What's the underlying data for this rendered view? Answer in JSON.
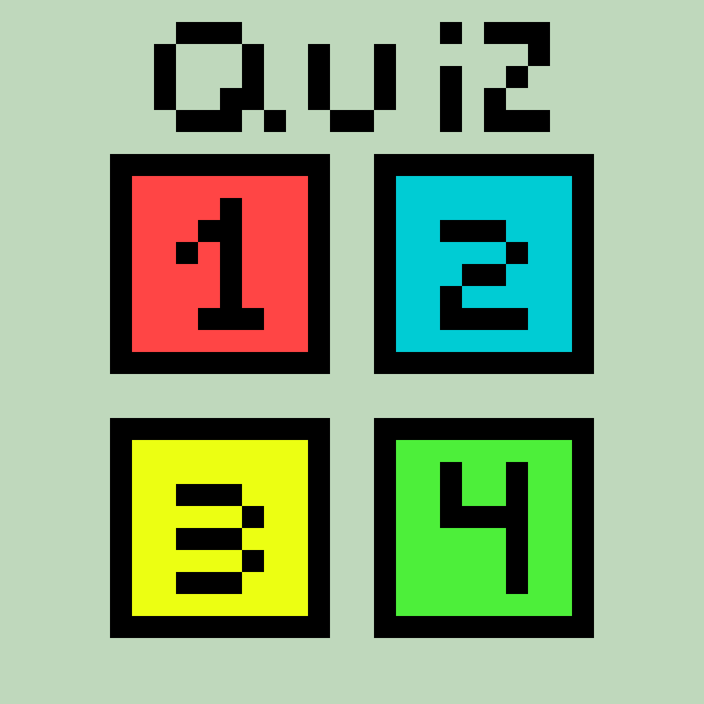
{
  "title": "Quiz",
  "background_color": "#BFD8BC",
  "border_color": "#000000",
  "answers": [
    {
      "label": "1",
      "color": "#FF4545"
    },
    {
      "label": "2",
      "color": "#00CCD4"
    },
    {
      "label": "3",
      "color": "#ECFF12"
    },
    {
      "label": "4",
      "color": "#4DEF3A"
    }
  ]
}
